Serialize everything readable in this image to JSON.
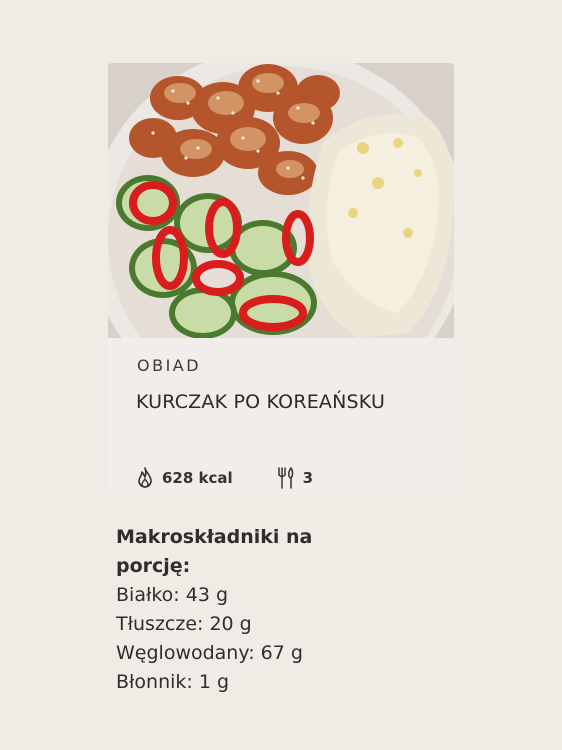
{
  "recipe_card": {
    "category": "OBIAD",
    "title": "KURCZAK PO KOREAŃSKU",
    "calories": "628 kcal",
    "servings": "3",
    "calories_icon": "flame-icon",
    "servings_icon": "fork-knife-icon"
  },
  "macros": {
    "heading": "Makroskładniki na porcję:",
    "protein": "Białko: 43 g",
    "fat": "Tłuszcze: 20 g",
    "carbs": "Węglowodany: 67 g",
    "fiber": "Błonnik: 1 g"
  },
  "colors": {
    "page_background": "#f1ebe5",
    "card_background": "#f1edea",
    "text": "#2b2b2b"
  }
}
